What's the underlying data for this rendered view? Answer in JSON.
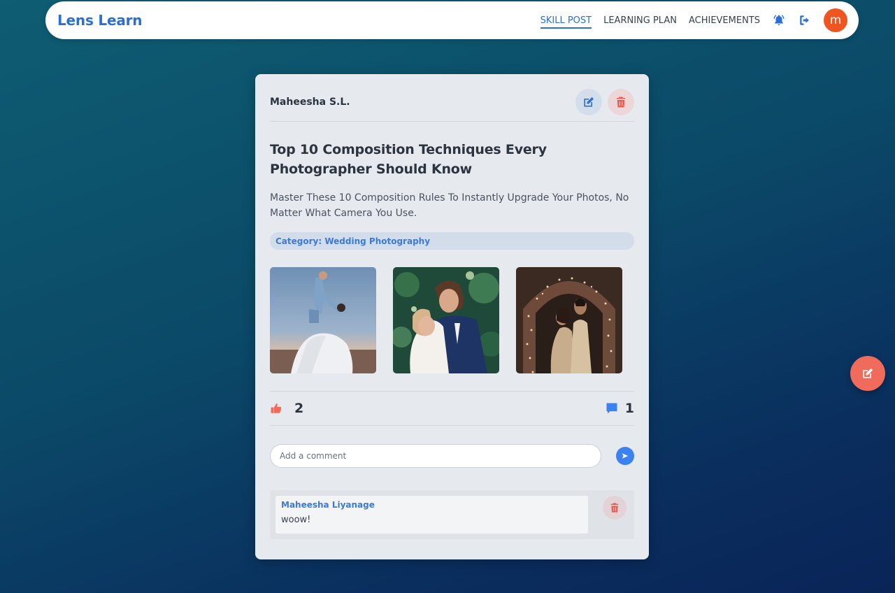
{
  "app": {
    "brand": "Lens Learn"
  },
  "nav": {
    "links": [
      {
        "label": "SKILL POST",
        "active": true
      },
      {
        "label": "LEARNING PLAN",
        "active": false
      },
      {
        "label": "ACHIEVEMENTS",
        "active": false
      }
    ],
    "icons": [
      "bell-icon",
      "logout-icon"
    ],
    "avatar_initial": "m",
    "avatar_color": "#ee5520"
  },
  "post": {
    "author": "Maheesha S.L.",
    "title": "Top 10 Composition Techniques Every Photographer Should Know",
    "description": "Master These 10 Composition Rules To Instantly Upgrade Your Photos, No Matter What Camera You Use.",
    "category_label": "Category:",
    "category_value": "Wedding Photography",
    "images": [
      "wedding-photo-dip",
      "wedding-photo-embrace",
      "wedding-photo-light-arch"
    ],
    "likes": "2",
    "comments_count": "1"
  },
  "comment_form": {
    "placeholder": "Add a comment"
  },
  "comments": [
    {
      "author": "Maheesha Liyanage",
      "text": "woow!"
    }
  ],
  "colors": {
    "accent": "#2a6ed6",
    "danger": "#f06b5c",
    "like": "#f06b5c",
    "comment": "#3b82f0"
  }
}
